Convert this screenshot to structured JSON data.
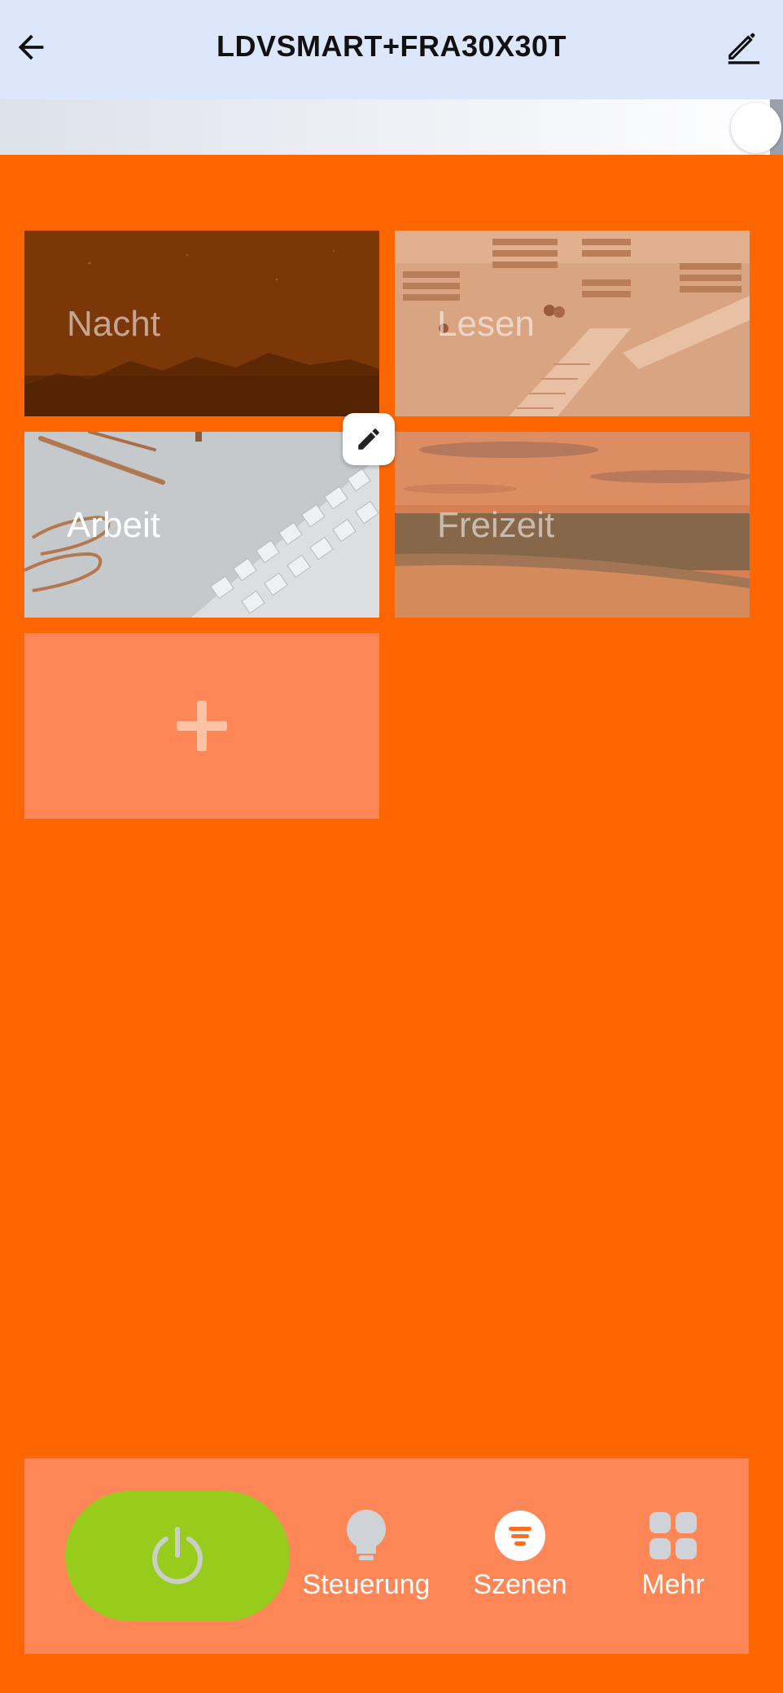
{
  "header": {
    "title": "LDVSMART+FRA30X30T",
    "back_icon": "arrow-left-icon",
    "edit_icon": "pencil-icon"
  },
  "brightness": {
    "level": 1.0
  },
  "scenes": [
    {
      "label": "Nacht",
      "selected": false,
      "image": "night-sky-silhouette"
    },
    {
      "label": "Lesen",
      "selected": false,
      "image": "library-interior"
    },
    {
      "label": "Arbeit",
      "selected": true,
      "image": "keyboard-pens-paperclips"
    },
    {
      "label": "Freizeit",
      "selected": false,
      "image": "beach-sunset"
    }
  ],
  "add_scene": {
    "icon": "plus-icon"
  },
  "bottom_nav": {
    "power_icon": "power-icon",
    "items": [
      {
        "label": "Steuerung",
        "icon": "bulb-icon",
        "active": false
      },
      {
        "label": "Szenen",
        "icon": "scenes-icon",
        "active": true
      },
      {
        "label": "Mehr",
        "icon": "grid-icon",
        "active": false
      }
    ]
  },
  "colors": {
    "background": "#ff6600",
    "header": "#dde7fb",
    "panel": "#ff8657",
    "power": "#97cc1c"
  }
}
